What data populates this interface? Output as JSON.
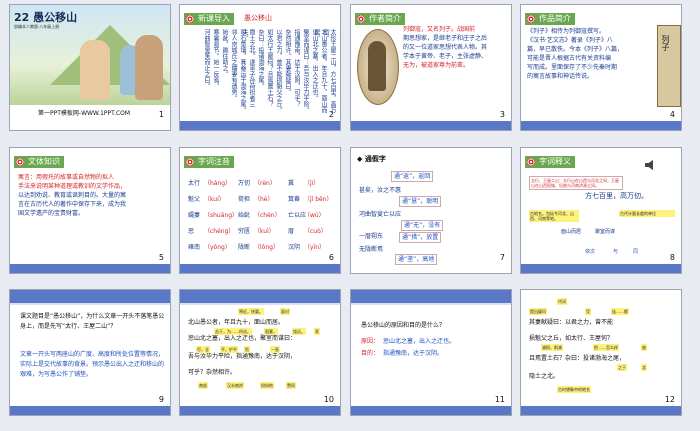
{
  "slides": [
    {
      "num": "1",
      "title": "22 愚公移山",
      "subtitle": "部编本人教版·八年级上册",
      "footer": "第一PPT模板网-WWW.1PPT.COM"
    },
    {
      "num": "2",
      "badge": "新课导入",
      "heading": "愚公移山"
    },
    {
      "num": "3",
      "badge": "作者简介",
      "lines": [
        "列御寇，又名列子。战国前",
        "期思想家，是继老子和庄子之后",
        "的又一位道家思想代表人物。其",
        "学本于黄帝、老子，主张虚静、",
        "无为，被道家尊为前辈。"
      ]
    },
    {
      "num": "4",
      "badge": "作品简介",
      "lines": [
        "《列子》相传为列御寇撰写。",
        "《汉书·艺文志》著录《列子》八",
        "篇，早已散佚。今本《列子》八篇，",
        "可能是晋人根据古代有关资料编",
        "写而成。里面保存了不少先秦时期",
        "的寓言故事和神话传说。"
      ],
      "book": "列子"
    },
    {
      "num": "5",
      "badge": "文体知识",
      "lines": [
        "寓言：用假托的故事或自然物的拟人",
        "手法来说明某种道理或教训的文学作品，",
        "以达到劝说、教育或讽刺目的。大量的寓",
        "言在古历代人的著作中保存下来，成为我",
        "国文学遗产的宝贵财富。"
      ]
    },
    {
      "num": "6",
      "badge": "字词注音",
      "words": [
        {
          "w": "太行",
          "p": "háng"
        },
        {
          "w": "万仞",
          "p": "rèn"
        },
        {
          "w": "冀",
          "p": "jì"
        },
        {
          "w": "魁父",
          "p": "kuí"
        },
        {
          "w": "荷担",
          "p": "hè"
        },
        {
          "w": "箕畚",
          "p": "jī běn"
        },
        {
          "w": "孀妻",
          "p": "shuāng"
        },
        {
          "w": "始龀",
          "p": "chèn"
        },
        {
          "w": "亡以应",
          "p": "wú"
        },
        {
          "w": "惩",
          "p": "chéng"
        },
        {
          "w": "穷匮",
          "p": "kuì"
        },
        {
          "w": "厝",
          "p": "cuò"
        },
        {
          "w": "雍南",
          "p": "yōng"
        },
        {
          "w": "陇断",
          "p": "lǒng"
        },
        {
          "w": "汉阴",
          "p": "yīn"
        }
      ]
    },
    {
      "num": "7",
      "heading": "◆ 通假字",
      "rows": [
        "通“返”，返回",
        "甚矣，汝之不惠",
        "通“慧”，聪明",
        "河曲智叟亡以应",
        "通“无”，没有",
        "一厝朔东",
        "通“措”，放置",
        "无陇断焉",
        "通“垄”，高地"
      ]
    },
    {
      "num": "8",
      "badge": "字词释义",
      "notes": [
        "太行、王屋二山：太行山在山西与河北之间，王屋山在山西阳城、垣曲与河南济源之间。",
        "方七百里，高万仞。",
        "古地名。包括今河北、山西、河南等地。",
        "古代计量长度的单位",
        "面山而居",
        "聚室而谋",
        "依次",
        "与",
        "同"
      ]
    },
    {
      "num": "9",
      "q": "课文题目是“愚公移山”，为什么文章一开头不落笔愚公身上，而是先写“太行、王屋二山”？",
      "a": "文章一开头写两座山的广度、高度和所处位置等情况，实际上是交代故事的背景。预示愚公出入之迂和移山的艰难，为写愚公作了铺垫。"
    },
    {
      "num": "10",
      "lines": [
        "北山愚公者，年且九十，面山而居。",
        "惩山北之塞，出入之迂也，聚室而谋曰：",
        "吾与汝毕力平险，指通豫南，达于汉阴，",
        "可乎？杂然相许。"
      ],
      "notes": [
        "将近，快要。",
        "面对",
        "苦于，为……所苦。",
        "阻塞，",
        "绕远。",
        "家",
        "尽，全",
        "平，铲平",
        "险",
        "一直",
        "南部",
        "汉水南岸",
        "纷纷地",
        "赞同"
      ]
    },
    {
      "num": "11",
      "q": "愚公移山的原因和目的是什么？",
      "reason_label": "原因：",
      "reason": "惩山北之塞，出入之迂也。",
      "goal_label": "目的：",
      "goal": "指通豫南，达于汉阴。"
    },
    {
      "num": "12",
      "lines": [
        "其妻献疑曰：以君之力，曾不能",
        "损魁父之丘，如太行、王屋何？",
        "且焉置土石？杂曰：投诸渤海之尾，",
        "隐土之北。"
      ],
      "notes": [
        "代词",
        "提出疑问",
        "凭",
        "连……都",
        "减损，削减",
        "把……怎么样",
        "放",
        "古时想象中的地名",
        "之于",
        "北"
      ]
    }
  ]
}
